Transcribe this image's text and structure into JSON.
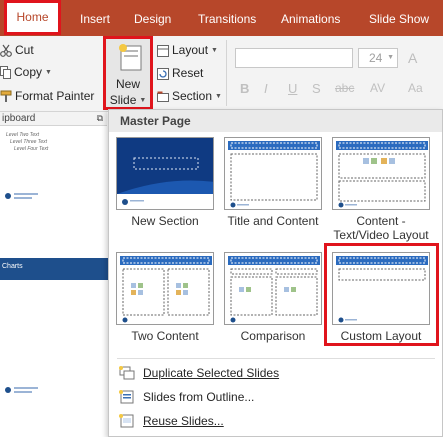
{
  "ribbon_tabs": [
    "Home",
    "Insert",
    "Design",
    "Transitions",
    "Animations",
    "Slide Show"
  ],
  "active_tab": "Home",
  "clipboard": {
    "cut_label": "Cut",
    "copy_label": "Copy",
    "format_painter_label": "Format Painter",
    "group_label": "ipboard"
  },
  "slides_group": {
    "new_slide_line1": "New",
    "new_slide_line2": "Slide",
    "layout_label": "Layout",
    "reset_label": "Reset",
    "section_label": "Section"
  },
  "font": {
    "size_value": "24"
  },
  "left_pane": {
    "thumb1_lines": [
      "Level Two Text",
      "Level Three Text",
      "Level Four Text"
    ],
    "thumb2_title": "Charts"
  },
  "gallery": {
    "header": "Master Page",
    "layouts": [
      {
        "label": "New Section",
        "label2": ""
      },
      {
        "label": "Title and Content",
        "label2": ""
      },
      {
        "label": "Content -",
        "label2": "Text/Video Layout"
      },
      {
        "label": "Two Content",
        "label2": ""
      },
      {
        "label": "Comparison",
        "label2": ""
      },
      {
        "label": "Custom Layout",
        "label2": ""
      }
    ]
  },
  "menu": [
    {
      "label": "Duplicate Selected Slides",
      "icon": "duplicate-slides-icon"
    },
    {
      "label": "Slides from Outline...",
      "icon": "outline-icon"
    },
    {
      "label": "Reuse Slides...",
      "icon": "reuse-slides-icon"
    }
  ],
  "colors": {
    "ribbon_accent": "#b7472a",
    "highlight_red": "#e0141c",
    "slide_blue": "#1e4f8c",
    "section_blue": "#0e2f6b"
  }
}
